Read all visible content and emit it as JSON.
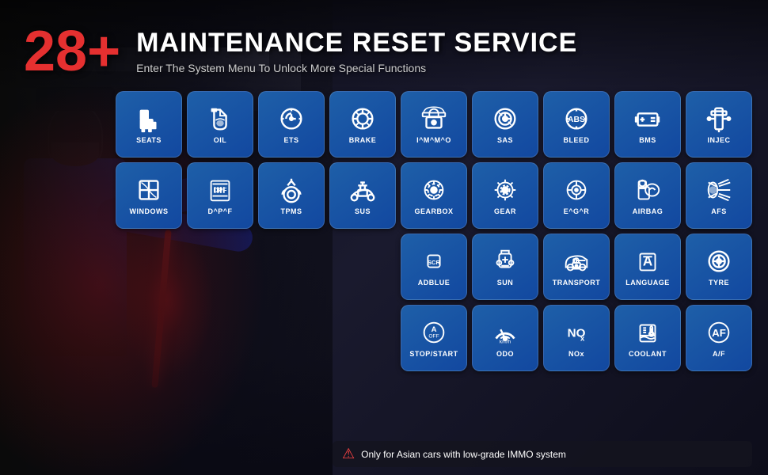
{
  "header": {
    "badge": "28+",
    "title": "MAINTENANCE RESET SERVICE",
    "subtitle": "Enter The System Menu To Unlock More Special Functions"
  },
  "warning": {
    "text": "Only for Asian cars with low-grade IMMO system"
  },
  "tiles": [
    [
      {
        "id": "seats",
        "label": "SEATS",
        "icon": "seat"
      },
      {
        "id": "oil",
        "label": "OIL",
        "icon": "oil"
      },
      {
        "id": "ets",
        "label": "ETS",
        "icon": "ets"
      },
      {
        "id": "brake",
        "label": "BRAKE",
        "icon": "brake"
      },
      {
        "id": "immo",
        "label": "I^M^M^O",
        "icon": "immo"
      },
      {
        "id": "sas",
        "label": "SAS",
        "icon": "sas"
      },
      {
        "id": "bleed",
        "label": "BLEED",
        "icon": "bleed"
      },
      {
        "id": "bms",
        "label": "BMS",
        "icon": "bms"
      },
      {
        "id": "injec",
        "label": "INJEC",
        "icon": "injec"
      }
    ],
    [
      {
        "id": "windows",
        "label": "WINDOWS",
        "icon": "windows"
      },
      {
        "id": "dpf",
        "label": "D^P^F",
        "icon": "dpf"
      },
      {
        "id": "tpms",
        "label": "TPMS",
        "icon": "tpms"
      },
      {
        "id": "sus",
        "label": "SUS",
        "icon": "sus"
      },
      {
        "id": "gearbox",
        "label": "GEARBOX",
        "icon": "gearbox"
      },
      {
        "id": "gear",
        "label": "GEAR",
        "icon": "gear"
      },
      {
        "id": "egr",
        "label": "E^G^R",
        "icon": "egr"
      },
      {
        "id": "airbag",
        "label": "AIRBAG",
        "icon": "airbag"
      },
      {
        "id": "afs",
        "label": "AFS",
        "icon": "afs"
      }
    ],
    [
      {
        "id": "adblue",
        "label": "ADBLUE",
        "icon": "adblue"
      },
      {
        "id": "sun",
        "label": "SUN",
        "icon": "sun"
      },
      {
        "id": "transport",
        "label": "TRANSPORT",
        "icon": "transport"
      },
      {
        "id": "language",
        "label": "LANGUAGE",
        "icon": "language"
      },
      {
        "id": "tyre",
        "label": "TYRE",
        "icon": "tyre"
      }
    ],
    [
      {
        "id": "stopstart",
        "label": "STOP/START",
        "icon": "stopstart"
      },
      {
        "id": "odo",
        "label": "ODO",
        "icon": "odo"
      },
      {
        "id": "nox",
        "label": "NOx",
        "icon": "nox"
      },
      {
        "id": "coolant",
        "label": "COOLANT",
        "icon": "coolant"
      },
      {
        "id": "af",
        "label": "A/F",
        "icon": "af"
      }
    ]
  ],
  "colors": {
    "tile_bg": "#1a52a0",
    "tile_border": "#2a6ac0",
    "text_white": "#ffffff",
    "accent_red": "#e53030",
    "bg_dark": "#0d1020"
  }
}
